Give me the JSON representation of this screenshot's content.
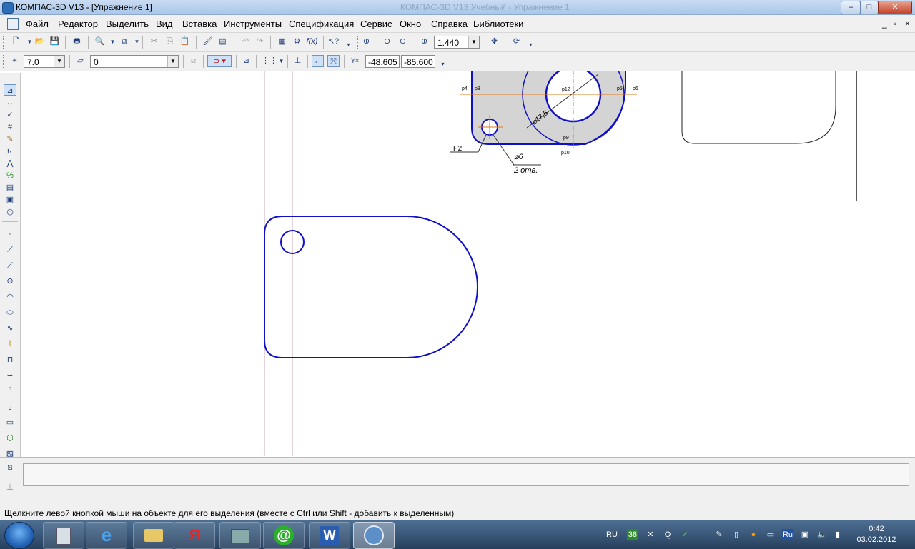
{
  "window": {
    "title": "КОМПАС-3D V13 - [Упражнение 1]",
    "background_title": "КОМПАС-3D V13 Учебный - Упражнение 1",
    "btn_min": "–",
    "btn_max": "□",
    "btn_close": "✕",
    "mdi_min": "_",
    "mdi_restore": "▫",
    "mdi_close": "×"
  },
  "menu": {
    "items": [
      "Файл",
      "Редактор",
      "Выделить",
      "Вид",
      "Вставка",
      "Инструменты",
      "Спецификация",
      "Сервис",
      "Окно",
      "Справка",
      "Библиотеки"
    ]
  },
  "toolbar1": {
    "zoom_value": "1.440"
  },
  "toolbar2": {
    "step_value": "7.0",
    "layer_value": "0",
    "coord_x": "-48.605",
    "coord_y": "-85.600"
  },
  "drawing": {
    "label_p2": "P2",
    "label_diam6": "⌀6",
    "label_2otv": "2 отв.",
    "label_diam17": "⌀17,5",
    "label_p4": "p4",
    "label_p3": "p3",
    "label_p12": "p12",
    "label_p9": "p9",
    "label_p10": "p10",
    "label_p5": "p5",
    "label_p6": "p6"
  },
  "status": {
    "message": "Щелкните левой кнопкой мыши на объекте для его выделения (вместе с Ctrl или Shift - добавить к выделенным)"
  },
  "taskbar": {
    "lang": "RU",
    "tray_badge": "38",
    "tray_ru": "Ru",
    "time": "0:42",
    "date": "03.02.2012"
  },
  "colors": {
    "drawing_line": "#1010c8",
    "axis_line": "#e07818",
    "part_fill": "#d4d4d4",
    "guide_line": "#c9a9b5"
  }
}
